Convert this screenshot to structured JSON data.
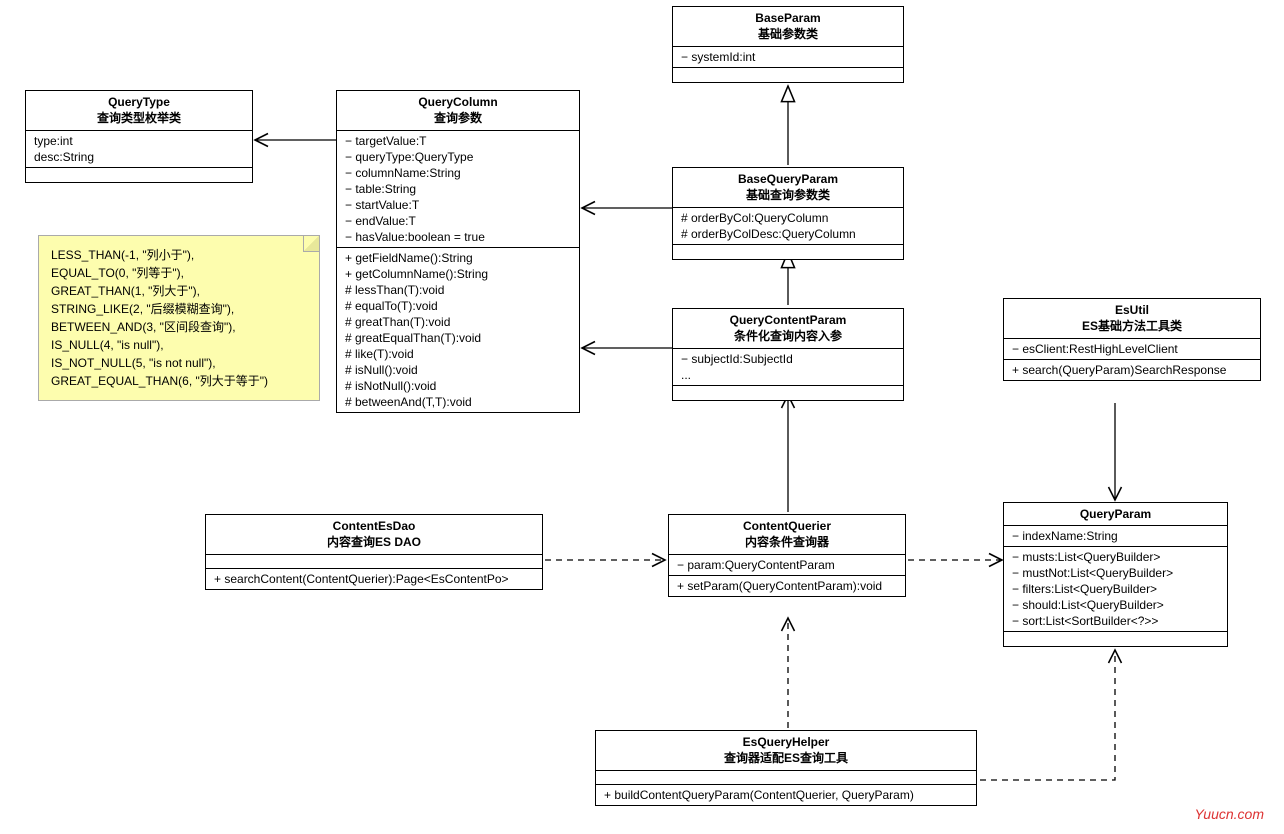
{
  "watermark": "Yuucn.com",
  "note": {
    "lines": [
      "LESS_THAN(-1, \"列小于\"),",
      "EQUAL_TO(0, \"列等于\"),",
      "GREAT_THAN(1, \"列大于\"),",
      "STRING_LIKE(2, \"后缀模糊查询\"),",
      "BETWEEN_AND(3, \"区间段查询\"),",
      "IS_NULL(4, \"is null\"),",
      "IS_NOT_NULL(5, \"is not null\"),",
      "GREAT_EQUAL_THAN(6, \"列大于等于\")"
    ]
  },
  "classes": {
    "queryType": {
      "title": "QueryType",
      "subtitle": "查询类型枚举类",
      "attrs": [
        "type:int",
        "desc:String"
      ]
    },
    "queryColumn": {
      "title": "QueryColumn",
      "subtitle": "查询参数",
      "attrs": [
        "− targetValue:T",
        "− queryType:QueryType",
        "− columnName:String",
        "− table:String",
        "− startValue:T",
        "− endValue:T",
        "− hasValue:boolean = true"
      ],
      "methods": [
        "+ getFieldName():String",
        "+ getColumnName():String",
        "# lessThan(T):void",
        "# equalTo(T):void",
        "# greatThan(T):void",
        "# greatEqualThan(T):void",
        "# like(T):void",
        "# isNull():void",
        "# isNotNull():void",
        "# betweenAnd(T,T):void"
      ]
    },
    "baseParam": {
      "title": "BaseParam",
      "subtitle": "基础参数类",
      "attrs": [
        "− systemId:int"
      ]
    },
    "baseQueryParam": {
      "title": "BaseQueryParam",
      "subtitle": "基础查询参数类",
      "attrs": [
        "# orderByCol:QueryColumn",
        "# orderByColDesc:QueryColumn"
      ]
    },
    "queryContentParam": {
      "title": "QueryContentParam",
      "subtitle": "条件化查询内容入参",
      "attrs": [
        "− subjectId:SubjectId",
        "..."
      ]
    },
    "esUtil": {
      "title": "EsUtil",
      "subtitle": "ES基础方法工具类",
      "attrs": [
        "− esClient:RestHighLevelClient"
      ],
      "methods": [
        "+ search(QueryParam)SearchResponse"
      ]
    },
    "contentEsDao": {
      "title": "ContentEsDao",
      "subtitle": "内容查询ES DAO",
      "methods": [
        "+ searchContent(ContentQuerier):Page<EsContentPo>"
      ]
    },
    "contentQuerier": {
      "title": "ContentQuerier",
      "subtitle": "内容条件查询器",
      "attrs": [
        "− param:QueryContentParam"
      ],
      "methods": [
        "+ setParam(QueryContentParam):void"
      ]
    },
    "queryParam": {
      "title": "QueryParam",
      "subtitle": "",
      "attrs": [
        "− indexName:String"
      ],
      "attrs2": [
        "− musts:List<QueryBuilder>",
        "− mustNot:List<QueryBuilder>",
        "− filters:List<QueryBuilder>",
        "− should:List<QueryBuilder>",
        "− sort:List<SortBuilder<?>>"
      ]
    },
    "esQueryHelper": {
      "title": "EsQueryHelper",
      "subtitle": "查询器适配ES查询工具",
      "methods": [
        "+ buildContentQueryParam(ContentQuerier, QueryParam)"
      ]
    }
  }
}
